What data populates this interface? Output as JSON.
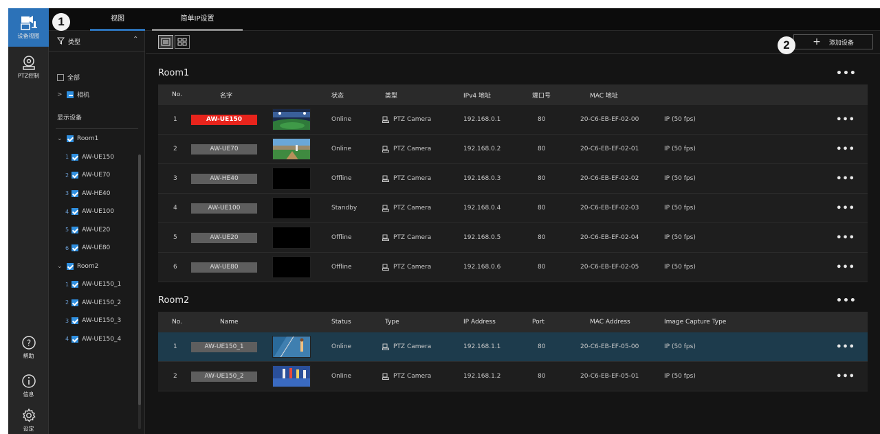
{
  "rail": {
    "items": [
      {
        "label": "设备视图",
        "icon": "camera-monitor-icon"
      },
      {
        "label": "PTZ控制",
        "icon": "ptz-camera-icon"
      },
      {
        "label": "帮助",
        "icon": "help-icon"
      },
      {
        "label": "信息",
        "icon": "info-icon"
      },
      {
        "label": "设定",
        "icon": "gear-icon"
      }
    ]
  },
  "tabs": [
    {
      "label": "视图"
    },
    {
      "label": "简单IP设置"
    }
  ],
  "badges": {
    "one": "1",
    "two": "2"
  },
  "filter": {
    "type_label": "类型",
    "all_label": "全部",
    "camera_label": "相机",
    "display_devices_label": "显示设备",
    "tree": [
      {
        "kind": "group",
        "label": "Room1"
      },
      {
        "kind": "child",
        "num": "1",
        "label": "AW-UE150"
      },
      {
        "kind": "child",
        "num": "2",
        "label": "AW-UE70"
      },
      {
        "kind": "child",
        "num": "3",
        "label": "AW-HE40"
      },
      {
        "kind": "child",
        "num": "4",
        "label": "AW-UE100"
      },
      {
        "kind": "child",
        "num": "5",
        "label": "AW-UE20"
      },
      {
        "kind": "child",
        "num": "6",
        "label": "AW-UE80"
      },
      {
        "kind": "group",
        "label": "Room2"
      },
      {
        "kind": "child",
        "num": "1",
        "label": "AW-UE150_1"
      },
      {
        "kind": "child",
        "num": "2",
        "label": "AW-UE150_2"
      },
      {
        "kind": "child",
        "num": "3",
        "label": "AW-UE150_3"
      },
      {
        "kind": "child",
        "num": "4",
        "label": "AW-UE150_4"
      }
    ]
  },
  "toolbar": {
    "add_device_label": "添加设备"
  },
  "more_label": "•••",
  "groups": [
    {
      "title": "Room1",
      "headers": [
        "No.",
        "名字",
        "状态",
        "类型",
        "IPv4 地址",
        "端口号",
        "MAC 地址"
      ],
      "rows": [
        {
          "no": "1",
          "name": "AW-UE150",
          "status": "Online",
          "type": "PTZ Camera",
          "ip": "192.168.0.1",
          "port": "80",
          "mac": "20-C6-EB-EF-02-00",
          "capture": "IP (50 fps)",
          "thumb": "stadium-thumbnail"
        },
        {
          "no": "2",
          "name": "AW-UE70",
          "status": "Online",
          "type": "PTZ Camera",
          "ip": "192.168.0.2",
          "port": "80",
          "mac": "20-C6-EB-EF-02-01",
          "capture": "IP (50 fps)",
          "thumb": "baseball-thumbnail"
        },
        {
          "no": "3",
          "name": "AW-HE40",
          "status": "Offline",
          "type": "PTZ Camera",
          "ip": "192.168.0.3",
          "port": "80",
          "mac": "20-C6-EB-EF-02-02",
          "capture": "IP (50 fps)",
          "thumb": "black-thumbnail"
        },
        {
          "no": "4",
          "name": "AW-UE100",
          "status": "Standby",
          "type": "PTZ Camera",
          "ip": "192.168.0.4",
          "port": "80",
          "mac": "20-C6-EB-EF-02-03",
          "capture": "IP (50 fps)",
          "thumb": "black-thumbnail"
        },
        {
          "no": "5",
          "name": "AW-UE20",
          "status": "Offline",
          "type": "PTZ Camera",
          "ip": "192.168.0.5",
          "port": "80",
          "mac": "20-C6-EB-EF-02-04",
          "capture": "IP (50 fps)",
          "thumb": "black-thumbnail"
        },
        {
          "no": "6",
          "name": "AW-UE80",
          "status": "Offline",
          "type": "PTZ Camera",
          "ip": "192.168.0.6",
          "port": "80",
          "mac": "20-C6-EB-EF-02-05",
          "capture": "IP (50 fps)",
          "thumb": "black-thumbnail"
        }
      ]
    },
    {
      "title": "Room2",
      "headers": [
        "No.",
        "Name",
        "Status",
        "Type",
        "IP Address",
        "Port",
        "MAC Address",
        "Image Capture Type"
      ],
      "rows": [
        {
          "no": "1",
          "name": "AW-UE150_1",
          "status": "Online",
          "type": "PTZ Camera",
          "ip": "192.168.1.1",
          "port": "80",
          "mac": "20-C6-EB-EF-05-00",
          "capture": "IP (50 fps)",
          "thumb": "tennis-thumbnail"
        },
        {
          "no": "2",
          "name": "AW-UE150_2",
          "status": "Online",
          "type": "PTZ Camera",
          "ip": "192.168.1.2",
          "port": "80",
          "mac": "20-C6-EB-EF-05-01",
          "capture": "IP (50 fps)",
          "thumb": "runners-thumbnail"
        }
      ]
    }
  ],
  "colors": {
    "accent": "#2c72b8",
    "checkbox": "#2f8fe0",
    "selected_row": "#1d3b4c",
    "highlight_chip": "#e8241c"
  }
}
